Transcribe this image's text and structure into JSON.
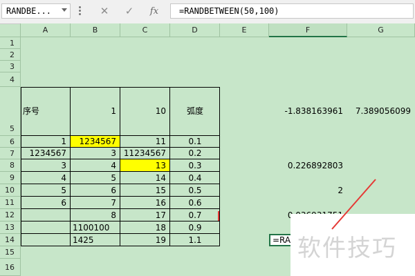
{
  "formula_bar": {
    "name_box": "RANDBE...",
    "formula": "=RANDBETWEEN(50,100)",
    "fx_label": "fx",
    "cancel_glyph": "✕",
    "enter_glyph": "✓"
  },
  "columns": [
    "A",
    "B",
    "C",
    "D",
    "E",
    "F",
    "G"
  ],
  "rows": [
    "1",
    "2",
    "3",
    "4",
    "5",
    "6",
    "7",
    "8",
    "9",
    "10",
    "11",
    "12",
    "13",
    "14",
    "15",
    "16"
  ],
  "cells": {
    "A5": "序号",
    "B5": "1",
    "C5": "10",
    "D5": "弧度",
    "F5": "-1.838163961",
    "G5": "7.389056099",
    "A6": "1",
    "B6": "1234567",
    "C6": "11",
    "D6": "0.1",
    "A7": "1234567",
    "B7": "3",
    "C7": "11234567",
    "D7": "0.2",
    "A8": "3",
    "B8": "4",
    "C8": "13",
    "D8": "0.3",
    "F8": "0.226892803",
    "A9": "4",
    "B9": "5",
    "C9": "14",
    "D9": "0.4",
    "A10": "5",
    "B10": "6",
    "C10": "15",
    "D10": "0.5",
    "F10": "2",
    "A11": "6",
    "B11": "7",
    "C11": "16",
    "D11": "0.6",
    "B12": "8",
    "C12": "17",
    "D12": "0.7",
    "F12": "0.036931751",
    "B13": "1100100",
    "C13": "18",
    "D13": "0.9",
    "B14": "1425",
    "C14": "19",
    "D14": "1.1",
    "F14": "=RANDBETWEEN(50,100)"
  },
  "watermark": "软件技巧",
  "colors": {
    "sheet_bg": "#c7e6c9",
    "highlight": "#ffff00",
    "annotation": "#e53935",
    "active_border": "#217346"
  }
}
